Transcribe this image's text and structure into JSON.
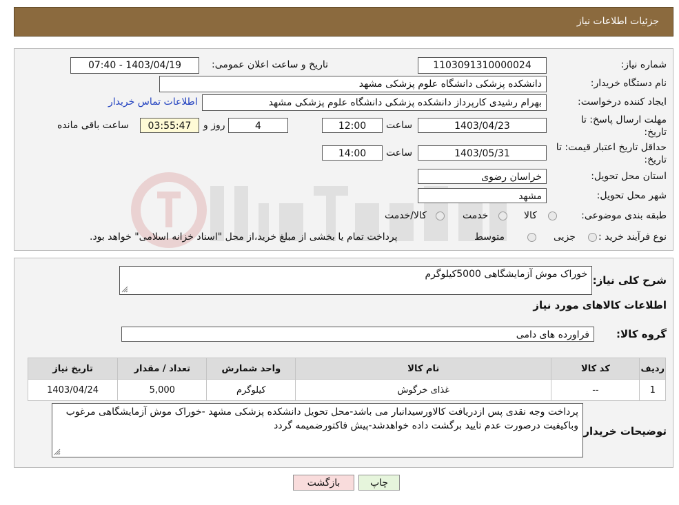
{
  "header": {
    "title": "جزئیات اطلاعات نیاز"
  },
  "form": {
    "need_number": {
      "label": "شماره نیاز:",
      "value": "1103091310000024"
    },
    "announce": {
      "label": "تاریخ و ساعت اعلان عمومی:",
      "value": "1403/04/19 - 07:40"
    },
    "buyer_org": {
      "label": "نام دستگاه خریدار:",
      "value": "دانشکده پزشکی   دانشگاه علوم پزشکی مشهد"
    },
    "requester": {
      "label": "ایجاد کننده درخواست:",
      "value": "بهرام رشیدی کارپرداز دانشکده پزشکی   دانشگاه علوم پزشکی مشهد"
    },
    "contact_link": "اطلاعات تماس خریدار",
    "deadline": {
      "label_line1": "مهلت ارسال پاسخ: تا",
      "label_line2": "تاریخ:",
      "date": "1403/04/23",
      "time_label": "ساعت",
      "time": "12:00",
      "days": "4",
      "days_label": "روز و",
      "remaining": "03:55:47",
      "remaining_label": "ساعت باقی مانده"
    },
    "price_validity": {
      "label_line1": "حداقل تاریخ اعتبار قیمت: تا",
      "label_line2": "تاریخ:",
      "date": "1403/05/31",
      "time_label": "ساعت",
      "time": "14:00"
    },
    "province": {
      "label": "استان محل تحویل:",
      "value": "خراسان رضوی"
    },
    "city": {
      "label": "شهر محل تحویل:",
      "value": "مشهد"
    },
    "category": {
      "label": "طبقه بندی موضوعی:",
      "options": [
        "کالا",
        "خدمت",
        "کالا/خدمت"
      ]
    },
    "purchase_type": {
      "label": "نوع فرآیند خرید :",
      "options": [
        "جزیی",
        "متوسط"
      ],
      "note": "پرداخت تمام یا بخشی از مبلغ خرید،از محل \"اسناد خزانه اسلامی\" خواهد بود."
    }
  },
  "details": {
    "description_label": "شرح کلی نیاز:",
    "description": "خوراک موش آزمایشگاهی 5000کیلوگرم",
    "goods_title": "اطلاعات کالاهای مورد نیاز",
    "group_label": "گروه کالا:",
    "group": "فراورده های دامی",
    "table": {
      "headers": [
        "ردیف",
        "کد کالا",
        "نام کالا",
        "واحد شمارش",
        "تعداد / مقدار",
        "تاریخ نیاز"
      ],
      "rows": [
        [
          "1",
          "--",
          "غذای خرگوش",
          "کیلوگرم",
          "5,000",
          "1403/04/24"
        ]
      ]
    },
    "buyer_notes_label": "توضیحات خریدار:",
    "buyer_notes": "پرداخت وجه نقدی پس ازدریافت کالاورسیدانبار می باشد-محل تحویل دانشکده پزشکی مشهد -خوراک موش آزمایشگاهی مرغوب وباکیفیت درصورت عدم تایید برگشت داده خواهدشد-پیش فاکتورضمیمه گردد"
  },
  "buttons": {
    "print": "چاپ",
    "back": "بازگشت"
  },
  "colors": {
    "header": "#8b6a3e",
    "panel": "#f3f3f3",
    "back_button": "#f9dcdc",
    "print_button": "#e6f5dc",
    "link": "#1f3fbf"
  }
}
